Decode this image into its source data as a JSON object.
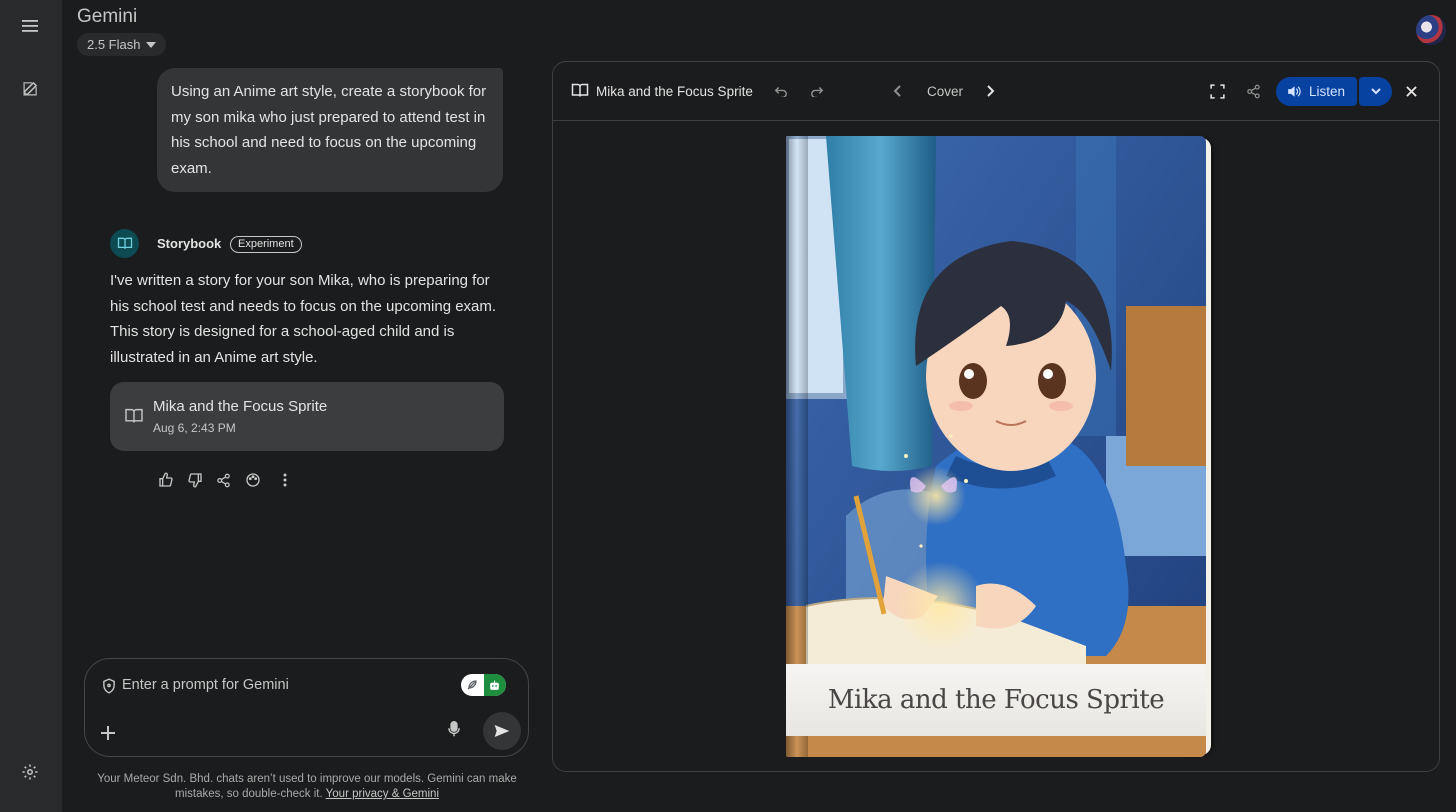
{
  "app": {
    "title": "Gemini",
    "model": "2.5 Flash"
  },
  "chat": {
    "user_prompt": "Using an Anime art style, create a storybook for my son mika who just prepared to attend test in his school and need to focus on the upcoming exam.",
    "agent_name": "Storybook",
    "agent_badge": "Experiment",
    "response": "I've written a story for your son Mika, who is preparing for his school test and needs to focus on the upcoming exam. This story is designed for a school-aged child and is illustrated in an Anime art style.",
    "card": {
      "title": "Mika and the Focus Sprite",
      "date": "Aug 6, 2:43 PM"
    }
  },
  "input": {
    "placeholder": "Enter a prompt for Gemini"
  },
  "footer": {
    "text": "Your Meteor Sdn. Bhd. chats aren’t used to improve our models. Gemini can make mistakes, so double-check it.",
    "link": "Your privacy & Gemini"
  },
  "panel": {
    "title": "Mika and the Focus Sprite",
    "page_label": "Cover",
    "listen_label": "Listen",
    "cover_title": "Mika and the Focus Sprite"
  },
  "colors": {
    "background": "#1b1c1d",
    "rail": "#282a2c",
    "listen": "#0842a0",
    "accent_green": "#1e8e3e"
  },
  "icons": [
    "menu-icon",
    "edit-icon",
    "settings-icon",
    "book-icon",
    "undo-icon",
    "redo-icon",
    "chevron-left-icon",
    "chevron-right-icon",
    "fullscreen-icon",
    "share-icon",
    "volume-icon",
    "chevron-down-icon",
    "close-icon",
    "thumb-up-icon",
    "thumb-down-icon",
    "palette-icon",
    "more-vert-icon",
    "shield-icon",
    "plus-icon",
    "mic-icon",
    "send-icon"
  ]
}
